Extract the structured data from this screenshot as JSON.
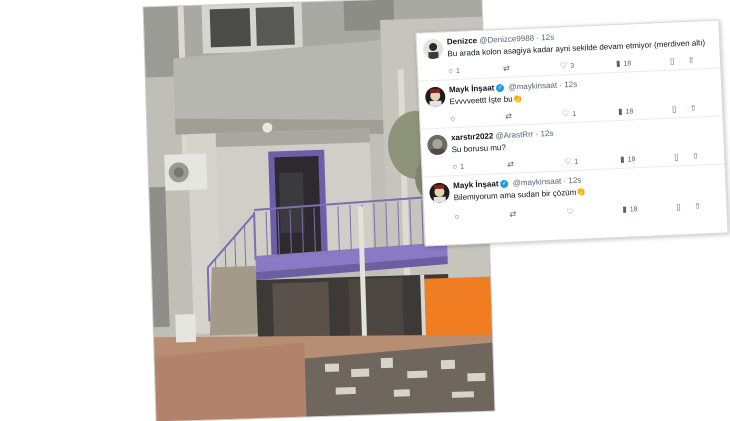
{
  "tweets": [
    {
      "name": "Denizce",
      "handle": "@Denizce9988",
      "time": "12s",
      "verified": false,
      "text": "Bu arada kolon asagiya kadar ayni sekilde devam etmiyor (merdiven altı)",
      "replies": "1",
      "retweets": "",
      "likes": "3",
      "views": "18"
    },
    {
      "name": "Mayk İnşaat",
      "handle": "@maykinsaat",
      "time": "12s",
      "verified": true,
      "text": "Evvvveettt İşte bu",
      "emoji": "👏",
      "replies": "",
      "retweets": "",
      "likes": "1",
      "views": "18"
    },
    {
      "name": "xarstır2022",
      "handle": "@ArastRrr",
      "time": "12s",
      "verified": false,
      "text": "Su borusu mu?",
      "replies": "1",
      "retweets": "",
      "likes": "1",
      "views": "18"
    },
    {
      "name": "Mayk İnşaat",
      "handle": "@maykinsaat",
      "time": "12s",
      "verified": true,
      "text": "Bilemiyorum ama sudan bir çözüm",
      "emoji": "👏",
      "replies": "",
      "retweets": "",
      "likes": "",
      "views": "18"
    }
  ],
  "sep": "·",
  "colors": {
    "verified": "#1d9bf0",
    "railing": "#7b6fb0",
    "landing": "#8a7ac6",
    "door_panel": "#f07d22",
    "door_frame": "#6a5fa8"
  },
  "icons": [
    "reply-icon",
    "retweet-icon",
    "like-icon",
    "views-icon",
    "bookmark-icon",
    "share-icon",
    "verified-icon"
  ]
}
